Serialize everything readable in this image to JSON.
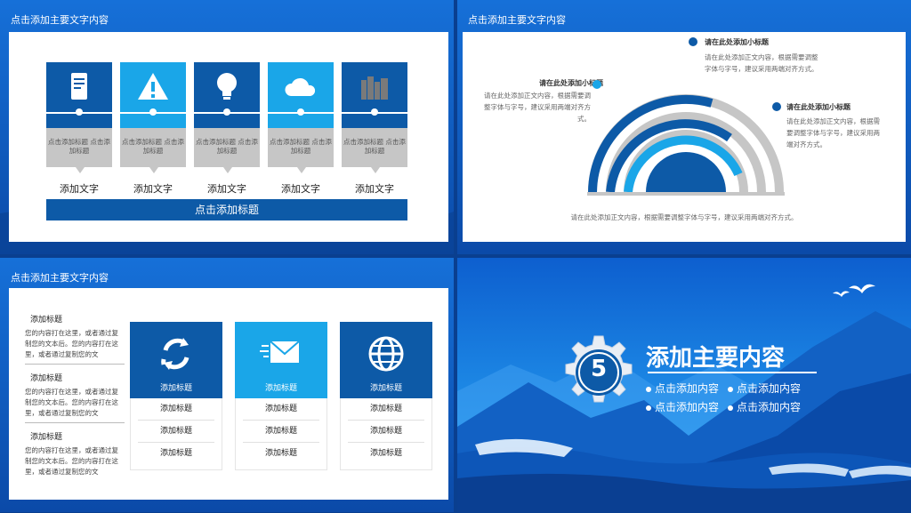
{
  "slide1": {
    "title": "点击添加主要文字内容",
    "items": [
      {
        "icon": "document-icon",
        "caption": "点击添加标题 点击添加标题",
        "label": "添加文字",
        "color": "#0d5aa7"
      },
      {
        "icon": "warning-icon",
        "caption": "点击添加标题 点击添加标题",
        "label": "添加文字",
        "color": "#1aa6e8"
      },
      {
        "icon": "lightbulb-icon",
        "caption": "点击添加标题 点击添加标题",
        "label": "添加文字",
        "color": "#0d5aa7"
      },
      {
        "icon": "cloud-icon",
        "caption": "点击添加标题 点击添加标题",
        "label": "添加文字",
        "color": "#1aa6e8"
      },
      {
        "icon": "books-icon",
        "caption": "点击添加标题 点击添加标题",
        "label": "添加文字",
        "color": "#0d5aa7"
      }
    ],
    "bottom_bar": "点击添加标题"
  },
  "slide2": {
    "title": "点击添加主要文字内容",
    "top_heading": "请在此处添加小标题",
    "top_text": "请在此处添加正文内容，根据需要调整字体与字号，建议采用两端对齐方式。",
    "left_heading": "请在此处添加小标题",
    "left_text": "请在此处添加正文内容，根据需要调整字体与字号，建议采用两端对齐方式。",
    "right_heading": "请在此处添加小标题",
    "right_text": "请在此处添加正文内容，根据需要调整字体与字号，建议采用两端对齐方式。",
    "footer": "请在此处添加正文内容，根据需要调整字体与字号，建议采用两端对齐方式。"
  },
  "slide3": {
    "title": "点击添加主要文字内容",
    "left_blocks": [
      {
        "heading": "添加标题",
        "text": "您的内容打在这里，或者通过复制您的文本后。您的内容打在这里，或者通过复制您的文"
      },
      {
        "heading": "添加标题",
        "text": "您的内容打在这里，或者通过复制您的文本后。您的内容打在这里，或者通过复制您的文"
      },
      {
        "heading": "添加标题",
        "text": "您的内容打在这里，或者通过复制您的文本后。您的内容打在这里，或者通过复制您的文"
      }
    ],
    "cards": [
      {
        "icon": "recycle-icon",
        "title": "添加标题",
        "color": "#0d5aa7",
        "rows": [
          "添加标题",
          "添加标题",
          "添加标题"
        ]
      },
      {
        "icon": "mail-icon",
        "title": "添加标题",
        "color": "#1aa6e8",
        "rows": [
          "添加标题",
          "添加标题",
          "添加标题"
        ]
      },
      {
        "icon": "globe-icon",
        "title": "添加标题",
        "color": "#0d5aa7",
        "rows": [
          "添加标题",
          "添加标题",
          "添加标题"
        ]
      }
    ]
  },
  "slide4": {
    "number": "5",
    "heading": "添加主要内容",
    "bullets": [
      "点击添加内容",
      "点击添加内容",
      "点击添加内容",
      "点击添加内容"
    ]
  }
}
